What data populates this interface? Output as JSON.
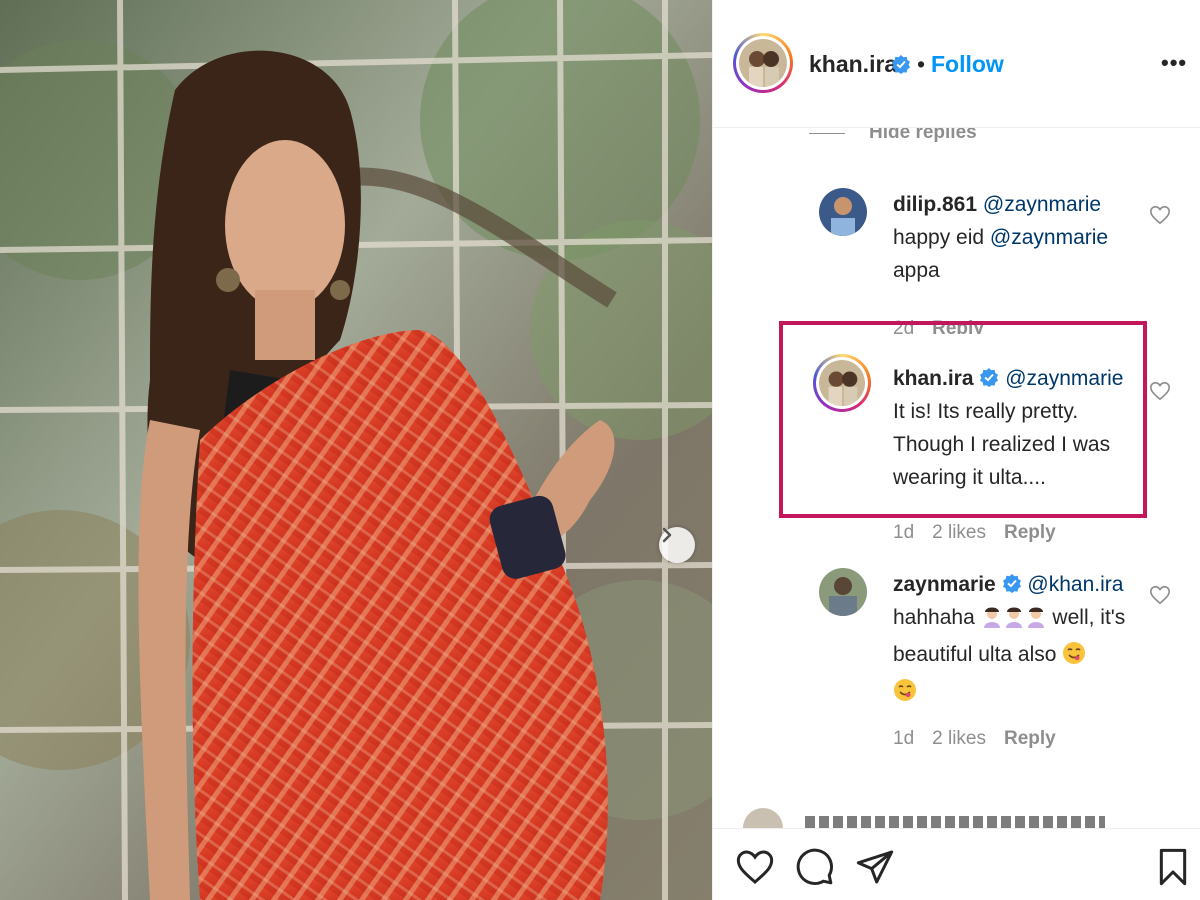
{
  "header": {
    "username": "khan.ira",
    "separator": "•",
    "follow_label": "Follow",
    "more_label": "•••"
  },
  "thread": {
    "hide_replies_label": "Hide replies"
  },
  "comments": [
    {
      "username": "dilip.861",
      "mention": "@zaynmarie",
      "text_before": "happy eid ",
      "text_mention": "@zaynmarie",
      "text_after": "appa",
      "time": "2d",
      "reply_label": "Reply"
    },
    {
      "username": "khan.ira",
      "verified": true,
      "mention": "@zaynmarie",
      "text": "It is! Its really pretty. Though I realized I was wearing it ulta....",
      "time": "1d",
      "likes": "2 likes",
      "reply_label": "Reply"
    },
    {
      "username": "zaynmarie",
      "verified": true,
      "mention": "@khan.ira",
      "text_start": "hahhaha ",
      "text_mid": " well, it's beautiful ulta also ",
      "time": "1d",
      "likes": "2 likes",
      "reply_label": "Reply"
    }
  ],
  "icons": {
    "verified": "verified-badge-icon",
    "heart": "heart-icon",
    "comment": "comment-icon",
    "share": "share-icon",
    "bookmark": "bookmark-icon",
    "carousel": "chevron-right-icon"
  },
  "colors": {
    "link_blue": "#0095f6",
    "mention": "#00376b",
    "meta_gray": "#8e8e8e",
    "highlight": "#c2185b",
    "saree_red": "#d93a26"
  }
}
